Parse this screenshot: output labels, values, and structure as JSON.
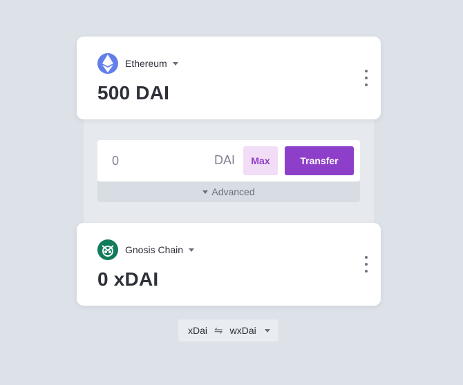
{
  "source": {
    "chain_name": "Ethereum",
    "chain_icon": "ethereum-icon",
    "balance": "500 DAI"
  },
  "transfer": {
    "amount_placeholder": "0",
    "unit": "DAI",
    "max_label": "Max",
    "transfer_label": "Transfer",
    "advanced_label": "Advanced",
    "accent_color": "#8e3fc9"
  },
  "destination": {
    "chain_name": "Gnosis Chain",
    "chain_icon": "gnosis-icon",
    "balance": "0 xDAI"
  },
  "token_toggle": {
    "left": "xDai",
    "right": "wxDai",
    "swap_icon": "swap-arrows-icon"
  }
}
